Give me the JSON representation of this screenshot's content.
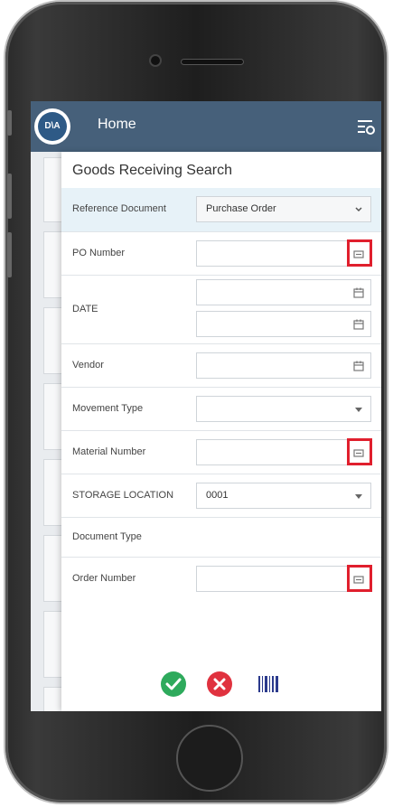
{
  "app": {
    "home_title": "Home",
    "logo_text": "D\\A"
  },
  "screen_title": "Goods Receiving Search",
  "form": {
    "reference_document": {
      "label": "Reference Document",
      "value": "Purchase Order"
    },
    "po_number": {
      "label": "PO Number",
      "value": ""
    },
    "date": {
      "label": "DATE",
      "from": "",
      "to": ""
    },
    "vendor": {
      "label": "Vendor",
      "value": ""
    },
    "movement_type": {
      "label": "Movement Type",
      "value": ""
    },
    "material_number": {
      "label": "Material Number",
      "value": ""
    },
    "storage_location": {
      "label": "STORAGE LOCATION",
      "value": "0001"
    },
    "document_type": {
      "label": "Document Type"
    },
    "order_number": {
      "label": "Order Number",
      "value": ""
    }
  },
  "actions": [
    "confirm-icon",
    "cancel-icon",
    "barcode-icon"
  ],
  "colors": {
    "topbar": "#46607a",
    "highlight": "#e01f2d",
    "confirm": "#2eaa5c",
    "cancel": "#e0323f",
    "barcode": "#2b3a8c"
  }
}
